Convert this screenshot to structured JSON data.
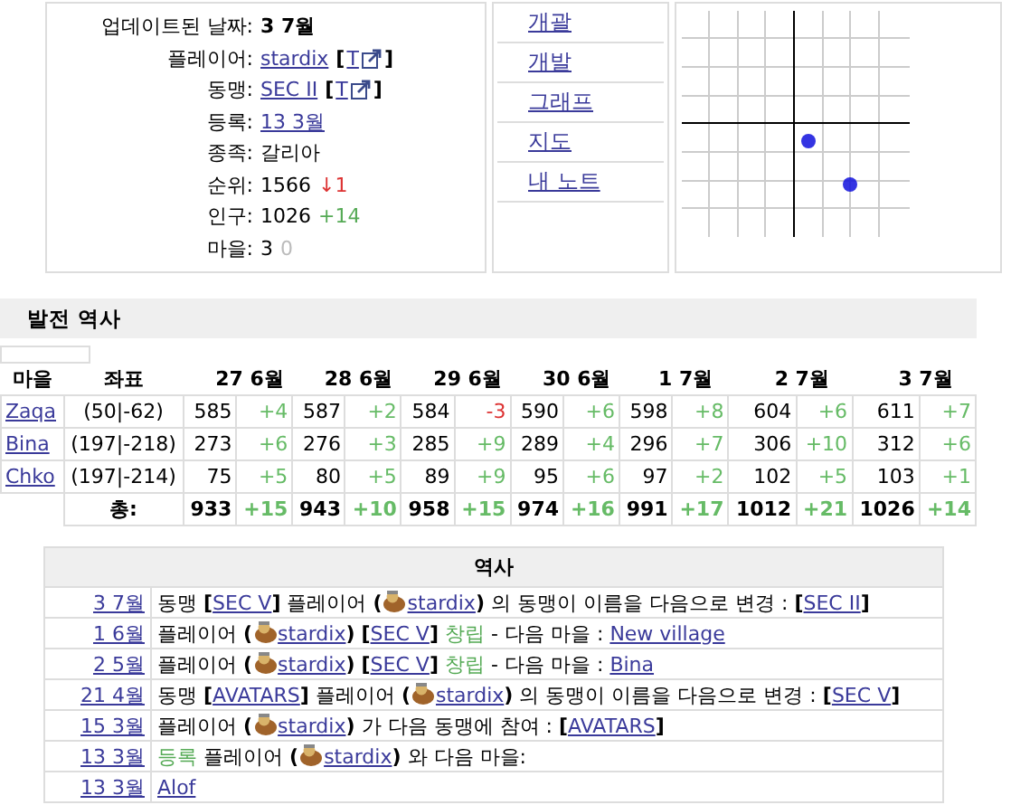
{
  "profile": {
    "rows": [
      {
        "label": "업데이트된 날짜:",
        "parts": [
          {
            "kind": "bold",
            "text": "3 7월"
          }
        ]
      },
      {
        "label": "플레이어:",
        "parts": [
          {
            "kind": "link",
            "text": "stardix"
          },
          {
            "kind": "ext",
            "open": "[",
            "text": "T",
            "close": "]"
          }
        ]
      },
      {
        "label": "동맹:",
        "parts": [
          {
            "kind": "link",
            "text": "SEC II"
          },
          {
            "kind": "ext",
            "open": "[",
            "text": "T",
            "close": "]"
          }
        ]
      },
      {
        "label": "등록:",
        "parts": [
          {
            "kind": "link",
            "text": "13 3월"
          }
        ]
      },
      {
        "label": "종족:",
        "parts": [
          {
            "kind": "text",
            "text": "갈리아"
          }
        ]
      },
      {
        "label": "순위:",
        "parts": [
          {
            "kind": "text",
            "text": "1566"
          },
          {
            "kind": "down",
            "text": "↓1"
          }
        ]
      },
      {
        "label": "인구:",
        "parts": [
          {
            "kind": "text",
            "text": "1026"
          },
          {
            "kind": "up",
            "text": "+14"
          }
        ]
      },
      {
        "label": "마을:",
        "parts": [
          {
            "kind": "text",
            "text": "3"
          },
          {
            "kind": "zero",
            "text": "0"
          }
        ]
      }
    ]
  },
  "menu": [
    "개괄",
    "개발",
    "그래프",
    "지도",
    "내 노트"
  ],
  "growth": {
    "title": "발전 역사",
    "columns": [
      "마을",
      "좌표",
      "27 6월",
      "28 6월",
      "29 6월",
      "30 6월",
      "1 7월",
      "2 7월",
      "3 7월"
    ],
    "rows": [
      {
        "village": "Zaqa",
        "coords": "(50|-62)",
        "counts": [
          {
            "value": "585",
            "delta": "+4",
            "color": "#66bb66"
          },
          {
            "value": "587",
            "delta": "+2",
            "color": "#66bb66"
          },
          {
            "value": "584",
            "delta": "-3",
            "color": "#dd3333"
          },
          {
            "value": "590",
            "delta": "+6",
            "color": "#66bb66"
          },
          {
            "value": "598",
            "delta": "+8",
            "color": "#66bb66"
          },
          {
            "value": "604",
            "delta": "+6",
            "color": "#66bb66"
          },
          {
            "value": "611",
            "delta": "+7",
            "color": "#66bb66"
          }
        ]
      },
      {
        "village": "Bina",
        "coords": "(197|-218)",
        "counts": [
          {
            "value": "273",
            "delta": "+6",
            "color": "#66bb66"
          },
          {
            "value": "276",
            "delta": "+3",
            "color": "#66bb66"
          },
          {
            "value": "285",
            "delta": "+9",
            "color": "#66bb66"
          },
          {
            "value": "289",
            "delta": "+4",
            "color": "#66bb66"
          },
          {
            "value": "296",
            "delta": "+7",
            "color": "#66bb66"
          },
          {
            "value": "306",
            "delta": "+10",
            "color": "#66bb66"
          },
          {
            "value": "312",
            "delta": "+6",
            "color": "#66bb66"
          }
        ]
      },
      {
        "village": "Chko",
        "coords": "(197|-214)",
        "counts": [
          {
            "value": "75",
            "delta": "+5",
            "color": "#66bb66"
          },
          {
            "value": "80",
            "delta": "+5",
            "color": "#66bb66"
          },
          {
            "value": "89",
            "delta": "+9",
            "color": "#66bb66"
          },
          {
            "value": "95",
            "delta": "+6",
            "color": "#66bb66"
          },
          {
            "value": "97",
            "delta": "+2",
            "color": "#66bb66"
          },
          {
            "value": "102",
            "delta": "+5",
            "color": "#66bb66"
          },
          {
            "value": "103",
            "delta": "+1",
            "color": "#66bb66"
          }
        ]
      }
    ],
    "total": {
      "label": "총:",
      "counts": [
        {
          "value": "933",
          "delta": "+15",
          "color": "#66bb66"
        },
        {
          "value": "943",
          "delta": "+10",
          "color": "#66bb66"
        },
        {
          "value": "958",
          "delta": "+15",
          "color": "#66bb66"
        },
        {
          "value": "974",
          "delta": "+16",
          "color": "#66bb66"
        },
        {
          "value": "991",
          "delta": "+17",
          "color": "#66bb66"
        },
        {
          "value": "1012",
          "delta": "+21",
          "color": "#66bb66"
        },
        {
          "value": "1026",
          "delta": "+14",
          "color": "#66bb66"
        }
      ]
    }
  },
  "history": {
    "title": "역사",
    "rows": [
      {
        "date": "3 7월",
        "parts": [
          {
            "kind": "text",
            "text": "동맹"
          },
          {
            "kind": "bold",
            "text": "["
          },
          {
            "kind": "link",
            "text": "SEC V"
          },
          {
            "kind": "bold",
            "text": "]"
          },
          {
            "kind": "text",
            "text": "플레이어"
          },
          {
            "kind": "bold",
            "text": "("
          },
          {
            "kind": "avatar",
            "text": "stardix"
          },
          {
            "kind": "bold",
            "text": ")"
          },
          {
            "kind": "text",
            "text": "의 동맹이 이름을 다음으로 변경 :"
          },
          {
            "kind": "bold",
            "text": "["
          },
          {
            "kind": "link",
            "text": "SEC II"
          },
          {
            "kind": "bold",
            "text": "]"
          }
        ]
      },
      {
        "date": "1 6월",
        "parts": [
          {
            "kind": "text",
            "text": "플레이어"
          },
          {
            "kind": "bold",
            "text": "("
          },
          {
            "kind": "avatar",
            "text": "stardix"
          },
          {
            "kind": "bold",
            "text": ")"
          },
          {
            "kind": "bold",
            "text": "["
          },
          {
            "kind": "link",
            "text": "SEC V"
          },
          {
            "kind": "bold",
            "text": "]"
          },
          {
            "kind": "green",
            "text": "창립"
          },
          {
            "kind": "text",
            "text": "- 다음 마을 :"
          },
          {
            "kind": "link",
            "text": "New village"
          }
        ]
      },
      {
        "date": "2 5월",
        "parts": [
          {
            "kind": "text",
            "text": "플레이어"
          },
          {
            "kind": "bold",
            "text": "("
          },
          {
            "kind": "avatar",
            "text": "stardix"
          },
          {
            "kind": "bold",
            "text": ")"
          },
          {
            "kind": "bold",
            "text": "["
          },
          {
            "kind": "link",
            "text": "SEC V"
          },
          {
            "kind": "bold",
            "text": "]"
          },
          {
            "kind": "green",
            "text": "창립"
          },
          {
            "kind": "text",
            "text": "- 다음 마을 :"
          },
          {
            "kind": "link",
            "text": "Bina"
          }
        ]
      },
      {
        "date": "21 4월",
        "parts": [
          {
            "kind": "text",
            "text": "동맹"
          },
          {
            "kind": "bold",
            "text": "["
          },
          {
            "kind": "link",
            "text": "AVATARS"
          },
          {
            "kind": "bold",
            "text": "]"
          },
          {
            "kind": "text",
            "text": "플레이어"
          },
          {
            "kind": "bold",
            "text": "("
          },
          {
            "kind": "avatar",
            "text": "stardix"
          },
          {
            "kind": "bold",
            "text": ")"
          },
          {
            "kind": "text",
            "text": "의 동맹이 이름을 다음으로 변경 :"
          },
          {
            "kind": "bold",
            "text": "["
          },
          {
            "kind": "link",
            "text": "SEC V"
          },
          {
            "kind": "bold",
            "text": "]"
          }
        ]
      },
      {
        "date": "15 3월",
        "parts": [
          {
            "kind": "text",
            "text": "플레이어"
          },
          {
            "kind": "bold",
            "text": "("
          },
          {
            "kind": "avatar",
            "text": "stardix"
          },
          {
            "kind": "bold",
            "text": ")"
          },
          {
            "kind": "text",
            "text": "가 다음 동맹에 참여 :"
          },
          {
            "kind": "bold",
            "text": "["
          },
          {
            "kind": "link",
            "text": "AVATARS"
          },
          {
            "kind": "bold",
            "text": "]"
          }
        ]
      },
      {
        "date": "13 3월",
        "parts": [
          {
            "kind": "green",
            "text": "등록"
          },
          {
            "kind": "text",
            "text": "플레이어"
          },
          {
            "kind": "bold",
            "text": "("
          },
          {
            "kind": "avatar",
            "text": "stardix"
          },
          {
            "kind": "bold",
            "text": ")"
          },
          {
            "kind": "text",
            "text": "와 다음 마을:"
          }
        ]
      },
      {
        "date": "13 3월",
        "parts": [
          {
            "kind": "link",
            "text": "Alof"
          }
        ]
      }
    ]
  }
}
